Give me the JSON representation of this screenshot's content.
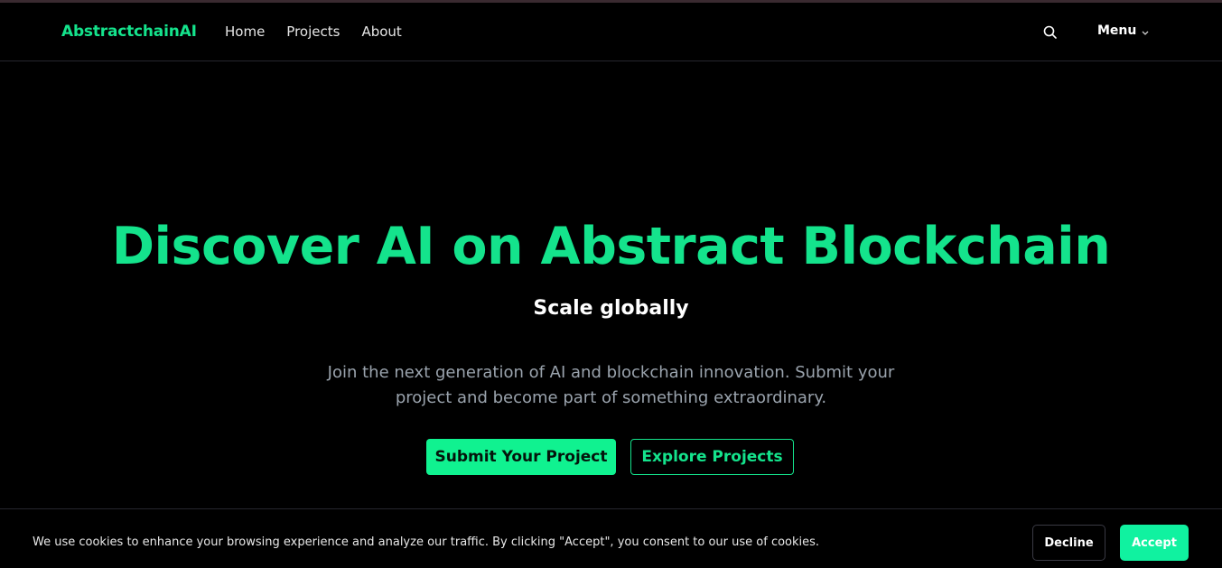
{
  "header": {
    "brand": "AbstractchainAI",
    "nav": [
      {
        "label": "Home"
      },
      {
        "label": "Projects"
      },
      {
        "label": "About"
      }
    ],
    "search_icon": "search-icon",
    "menu_label": "Menu",
    "menu_icon": "chevron-down-icon"
  },
  "hero": {
    "title": "Discover AI on Abstract Blockchain",
    "subtitle": "Scale globally",
    "description": "Join the next generation of AI and blockchain innovation. Submit your project and become part of something extraordinary.",
    "primary_button": "Submit Your Project",
    "secondary_button": "Explore Projects"
  },
  "cookie_banner": {
    "text": "We use cookies to enhance your browsing experience and analyze our traffic. By clicking \"Accept\", you consent to our use of cookies.",
    "decline_label": "Decline",
    "accept_label": "Accept"
  },
  "colors": {
    "accent": "#14e38c",
    "accent_button": "#10f290",
    "background": "#000000",
    "muted_text": "#9aa3ad"
  }
}
